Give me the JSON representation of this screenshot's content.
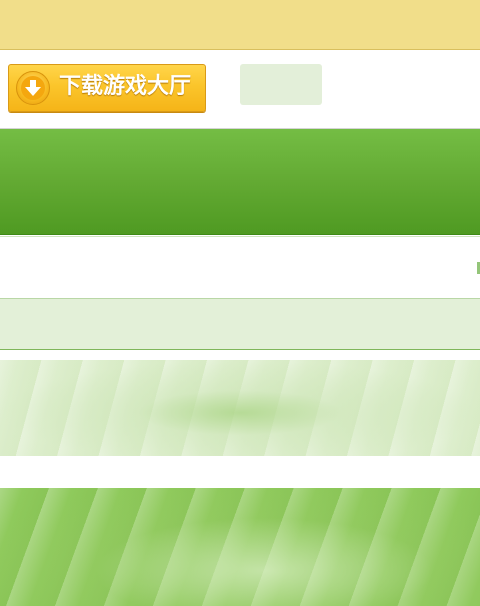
{
  "header": {
    "download_button_label": "下载游戏大厅"
  },
  "icons": {
    "download": "download-arrow-icon"
  },
  "colors": {
    "top_bar": "#f1de8a",
    "download_button": "#fbc52b",
    "green_banner": "#63aa33",
    "light_green_strip": "#e3f0d8"
  }
}
